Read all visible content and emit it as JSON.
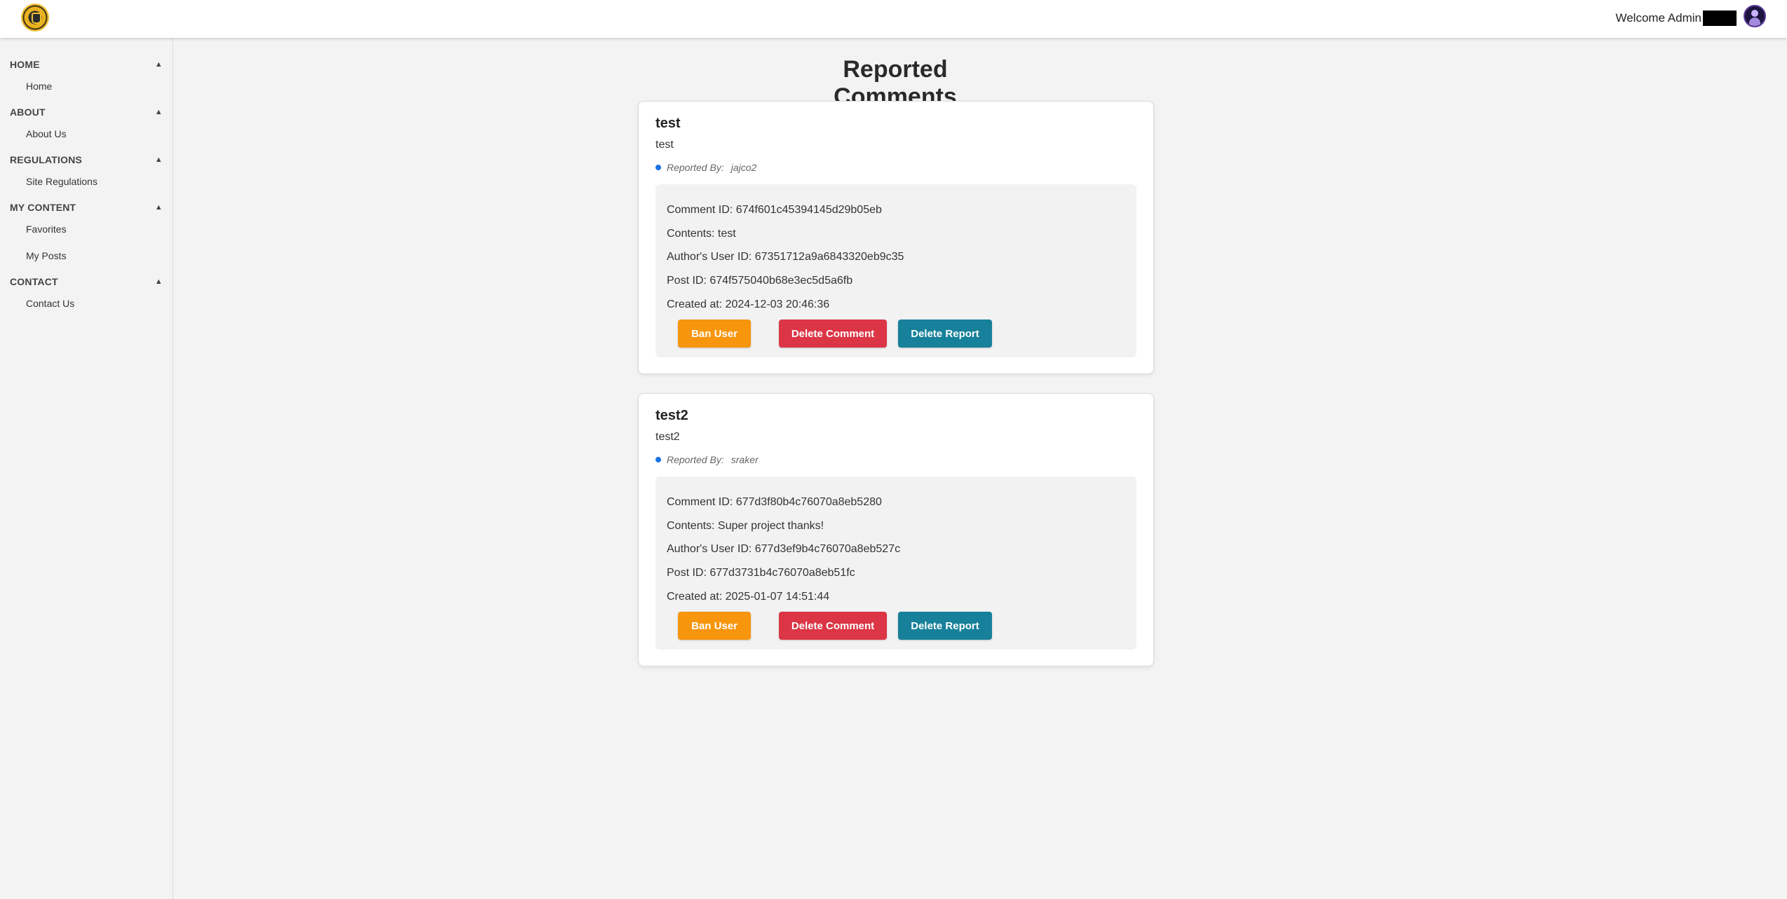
{
  "header": {
    "welcome_text": "Welcome Admin",
    "logo_icon": "badge-logo-icon",
    "avatar_icon": "user-avatar-icon"
  },
  "sidebar": {
    "sections": [
      {
        "title": "HOME",
        "caret": "▲",
        "items": [
          "Home"
        ]
      },
      {
        "title": "ABOUT",
        "caret": "▲",
        "items": [
          "About Us"
        ]
      },
      {
        "title": "REGULATIONS",
        "caret": "▲",
        "items": [
          "Site Regulations"
        ]
      },
      {
        "title": "MY CONTENT",
        "caret": "▲",
        "items": [
          "Favorites",
          "My Posts"
        ]
      },
      {
        "title": "CONTACT",
        "caret": "▲",
        "items": [
          "Contact Us"
        ]
      }
    ]
  },
  "main": {
    "title": "Reported Comments",
    "reports": [
      {
        "title": "test",
        "text": "test",
        "reported_by_label": "Reported By:",
        "reported_by": "jajco2",
        "comment_id": "Comment ID: 674f601c45394145d29b05eb",
        "contents": "Contents: test",
        "author_id": "Author's User ID: 67351712a9a6843320eb9c35",
        "post_id": "Post ID: 674f575040b68e3ec5d5a6fb",
        "created_at": "Created at: 2024-12-03 20:46:36",
        "ban_label": "Ban User",
        "delete_comment_label": "Delete Comment",
        "delete_report_label": "Delete Report"
      },
      {
        "title": "test2",
        "text": "test2",
        "reported_by_label": "Reported By:",
        "reported_by": "sraker",
        "comment_id": "Comment ID: 677d3f80b4c76070a8eb5280",
        "contents": "Contents: Super project thanks!",
        "author_id": "Author's User ID: 677d3ef9b4c76070a8eb527c",
        "post_id": "Post ID: 677d3731b4c76070a8eb51fc",
        "created_at": "Created at: 2025-01-07 14:51:44",
        "ban_label": "Ban User",
        "delete_comment_label": "Delete Comment",
        "delete_report_label": "Delete Report"
      }
    ]
  },
  "colors": {
    "ban": "#f7950d",
    "delete_comment": "#dc3545",
    "delete_report": "#17809a",
    "reporter_dot": "#1a73e8"
  }
}
